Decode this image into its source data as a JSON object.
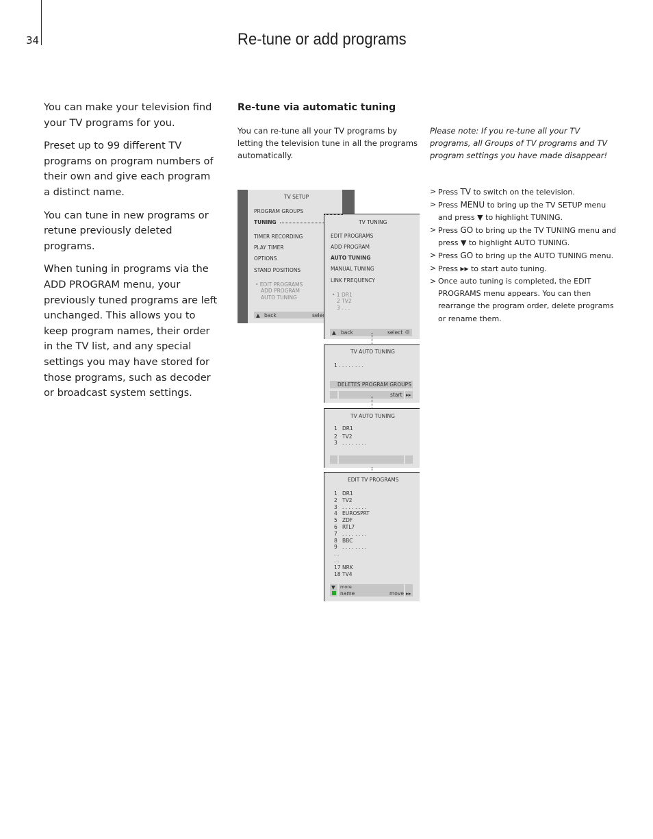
{
  "page_number": "34",
  "title": "Re-tune or add programs",
  "intro": [
    "You can make your television find your TV programs for you.",
    "Preset up to 99 different TV programs on program numbers of their own and give each program a distinct name.",
    "You can tune in new programs or retune previously deleted programs.",
    "When tuning in programs via the ADD PROGRAM menu, your previously tuned programs are left unchanged. This allows you to keep program names, their order in the TV list, and any special settings you may have stored for those programs, such as decoder or broadcast system settings."
  ],
  "section_heading": "Re-tune via automatic tuning",
  "lead": "You can re-tune all your TV programs by letting the television tune in all the programs automatically.",
  "note": "Please note: If you re-tune all your TV programs, all Groups of TV programs and TV program settings you have made disappear!",
  "steps": [
    {
      "a": "Press ",
      "k": "TV",
      "b": " to switch on the television."
    },
    {
      "a": "Press ",
      "k": "MENU",
      "b": " to bring up the TV SETUP menu and press ▼ to highlight TUNING."
    },
    {
      "a": "Press ",
      "k": "GO",
      "b": " to bring up the TV TUNING menu and press ▼ to highlight AUTO TUNING."
    },
    {
      "a": "Press ",
      "k": "GO",
      "b": " to bring up the AUTO TUNING menu."
    },
    {
      "a": "Press ",
      "k": "▸▸",
      "b": " to start auto tuning."
    },
    {
      "a": "Once auto tuning is completed, the EDIT PROGRAMS menu appears. You can then rearrange the program order, delete programs or rename them.",
      "k": "",
      "b": ""
    }
  ],
  "menus": {
    "setup": {
      "title": "TV  SETUP",
      "items": [
        "PROGRAM  GROUPS",
        "TUNING",
        "TIMER  RECORDING",
        "PLAY  TIMER",
        "OPTIONS",
        "STAND  POSITIONS"
      ],
      "sub": [
        "•  EDIT  PROGRAMS",
        "ADD  PROGRAM",
        "AUTO  TUNING"
      ],
      "back": "back",
      "select": "selec"
    },
    "tuning": {
      "title": "TV  TUNING",
      "items": [
        "EDIT  PROGRAMS",
        "ADD  PROGRAM",
        "AUTO  TUNING",
        "MANUAL  TUNING",
        "LINK  FREQUENCY"
      ],
      "sub": [
        "•  1 DR1",
        "2 TV2",
        "3 . . ."
      ],
      "back": "back",
      "select": "select"
    },
    "auto1": {
      "title": "TV  AUTO  TUNING",
      "row": "1   . . . . . . . .",
      "warning": "DELETES  PROGRAM  GROUPS",
      "start": "start"
    },
    "auto2": {
      "title": "TV  AUTO  TUNING",
      "rows": [
        [
          "1",
          "DR1"
        ],
        [
          "2",
          "TV2"
        ],
        [
          "3",
          ". . . . . . . ."
        ]
      ]
    },
    "edit": {
      "title": "EDIT  TV  PROGRAMS",
      "rows": [
        [
          "1",
          "DR1"
        ],
        [
          "2",
          "TV2"
        ],
        [
          "3",
          ". . . . . . . ."
        ],
        [
          "4",
          "EUROSPRT"
        ],
        [
          "5",
          "ZDF"
        ],
        [
          "6",
          "RTL7"
        ],
        [
          "7",
          ". . . . . . . ."
        ],
        [
          "8",
          "BBC"
        ],
        [
          "9",
          ". . . . . . . ."
        ],
        [
          ". .",
          ""
        ],
        [
          ". .",
          ""
        ],
        [
          "17",
          "NRK"
        ],
        [
          "18",
          "TV4"
        ]
      ],
      "more": "more",
      "name": "name",
      "move": "move"
    }
  }
}
